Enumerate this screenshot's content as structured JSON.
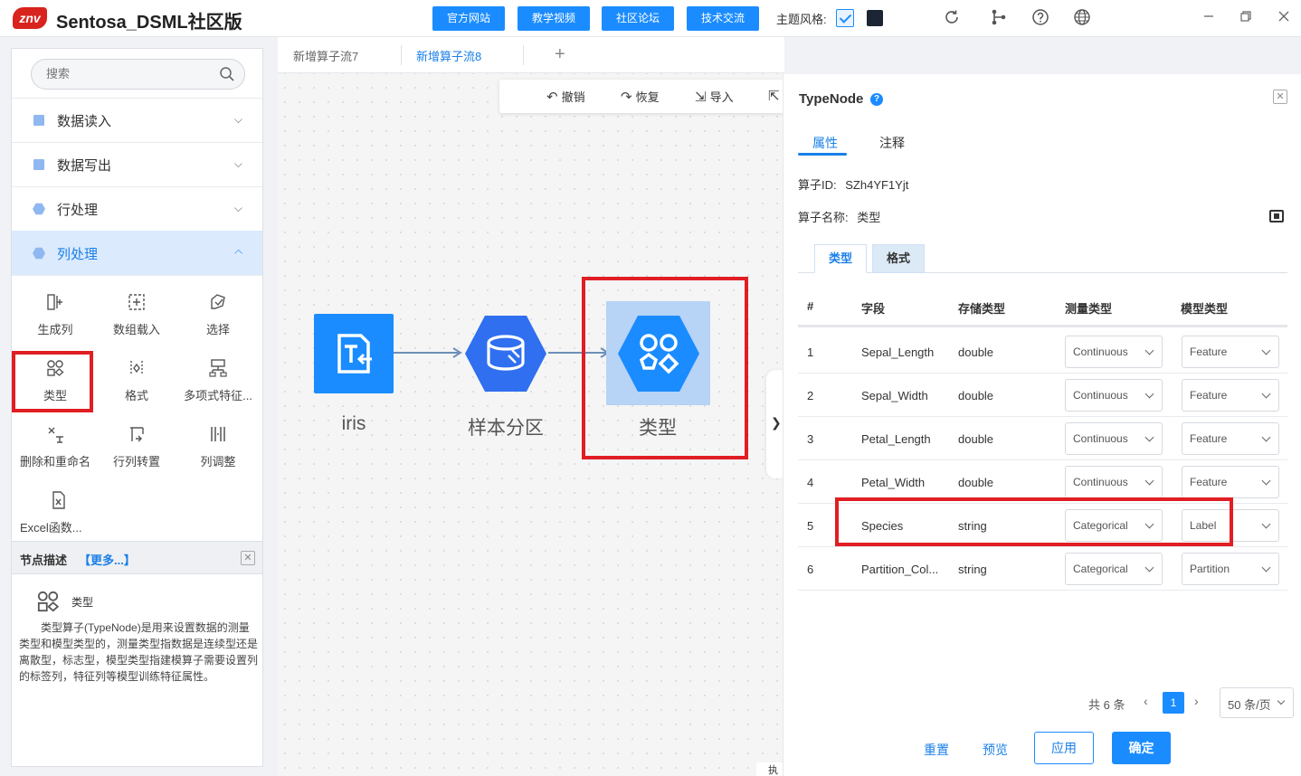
{
  "app": {
    "logo": "znv",
    "title": "Sentosa_DSML社区版",
    "nav_buttons": [
      "官方网站",
      "教学视频",
      "社区论坛",
      "技术交流"
    ],
    "theme_label": "主题风格:"
  },
  "sidebar": {
    "search_placeholder": "搜索",
    "categories": [
      {
        "label": "数据读入",
        "icon": "square-icon"
      },
      {
        "label": "数据写出",
        "icon": "square-icon"
      },
      {
        "label": "行处理",
        "icon": "hexagon-icon"
      },
      {
        "label": "列处理",
        "icon": "hexagon-icon",
        "expanded": true
      }
    ],
    "tools": [
      {
        "label": "生成列",
        "icon": "generate-column-icon"
      },
      {
        "label": "数组载入",
        "icon": "array-load-icon"
      },
      {
        "label": "选择",
        "icon": "select-icon"
      },
      {
        "label": "类型",
        "icon": "type-icon"
      },
      {
        "label": "格式",
        "icon": "format-icon"
      },
      {
        "label": "多项式特征...",
        "icon": "polynomial-icon"
      },
      {
        "label": "删除和重命名",
        "icon": "delete-rename-icon"
      },
      {
        "label": "行列转置",
        "icon": "transpose-icon"
      },
      {
        "label": "列调整",
        "icon": "column-adjust-icon"
      },
      {
        "label": "Excel函数...",
        "icon": "excel-icon"
      }
    ],
    "desc": {
      "title": "节点描述",
      "more": "【更多...】",
      "node_name": "类型",
      "text": "类型算子(TypeNode)是用来设置数据的测量类型和模型类型的，测量类型指数据是连续型还是离散型，标志型，模型类型指建模算子需要设置列的标签列，特征列等模型训练特征属性。"
    }
  },
  "canvas": {
    "tabs": [
      "新增算子流7",
      "新增算子流8"
    ],
    "active_tab": 1,
    "toolbar": [
      {
        "label": "撤销",
        "icon": "undo-icon"
      },
      {
        "label": "恢复",
        "icon": "redo-icon"
      },
      {
        "label": "导入",
        "icon": "import-icon"
      }
    ],
    "nodes": [
      {
        "label": "iris",
        "color": "#1a8cff"
      },
      {
        "label": "样本分区",
        "color": "#2f6ff0"
      },
      {
        "label": "类型",
        "color": "#1a8cff"
      }
    ],
    "exec_label": "执"
  },
  "panel": {
    "title": "TypeNode",
    "tabs": [
      "属性",
      "注释"
    ],
    "node_id_label": "算子ID:",
    "node_id": "SZh4YF1Yjt",
    "node_name_label": "算子名称:",
    "node_name": "类型",
    "sub_tabs": [
      "类型",
      "格式"
    ],
    "columns": [
      "#",
      "字段",
      "存储类型",
      "测量类型",
      "模型类型"
    ],
    "rows": [
      {
        "idx": "1",
        "field": "Sepal_Length",
        "storage": "double",
        "measure": "Continuous",
        "model": "Feature"
      },
      {
        "idx": "2",
        "field": "Sepal_Width",
        "storage": "double",
        "measure": "Continuous",
        "model": "Feature"
      },
      {
        "idx": "3",
        "field": "Petal_Length",
        "storage": "double",
        "measure": "Continuous",
        "model": "Feature"
      },
      {
        "idx": "4",
        "field": "Petal_Width",
        "storage": "double",
        "measure": "Continuous",
        "model": "Feature"
      },
      {
        "idx": "5",
        "field": "Species",
        "storage": "string",
        "measure": "Categorical",
        "model": "Label"
      },
      {
        "idx": "6",
        "field": "Partition_Col...",
        "storage": "string",
        "measure": "Categorical",
        "model": "Partition"
      }
    ],
    "pager": {
      "total": "共 6 条",
      "page": "1",
      "page_size": "50 条/页"
    },
    "actions": {
      "reset": "重置",
      "preview": "预览",
      "apply": "应用",
      "confirm": "确定"
    }
  },
  "colors": {
    "accent": "#1a8cff",
    "highlight": "#e01e23",
    "active_bg": "#dbeafd"
  }
}
